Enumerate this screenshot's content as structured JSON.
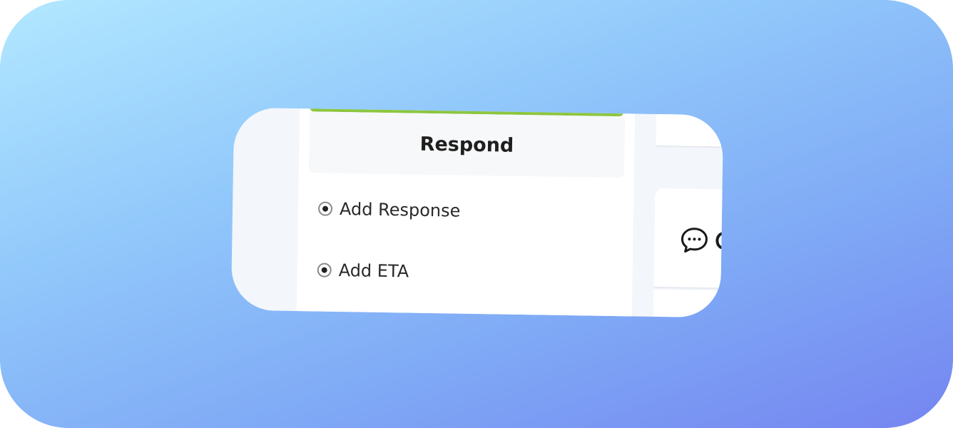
{
  "respond_panel": {
    "title": "Respond",
    "options": [
      {
        "label": "Add Response",
        "selected": true
      },
      {
        "label": "Add ETA",
        "selected": true
      }
    ],
    "accent_color": "#8cc63f"
  },
  "icons": {
    "chat": "chat-bubble-icon"
  }
}
